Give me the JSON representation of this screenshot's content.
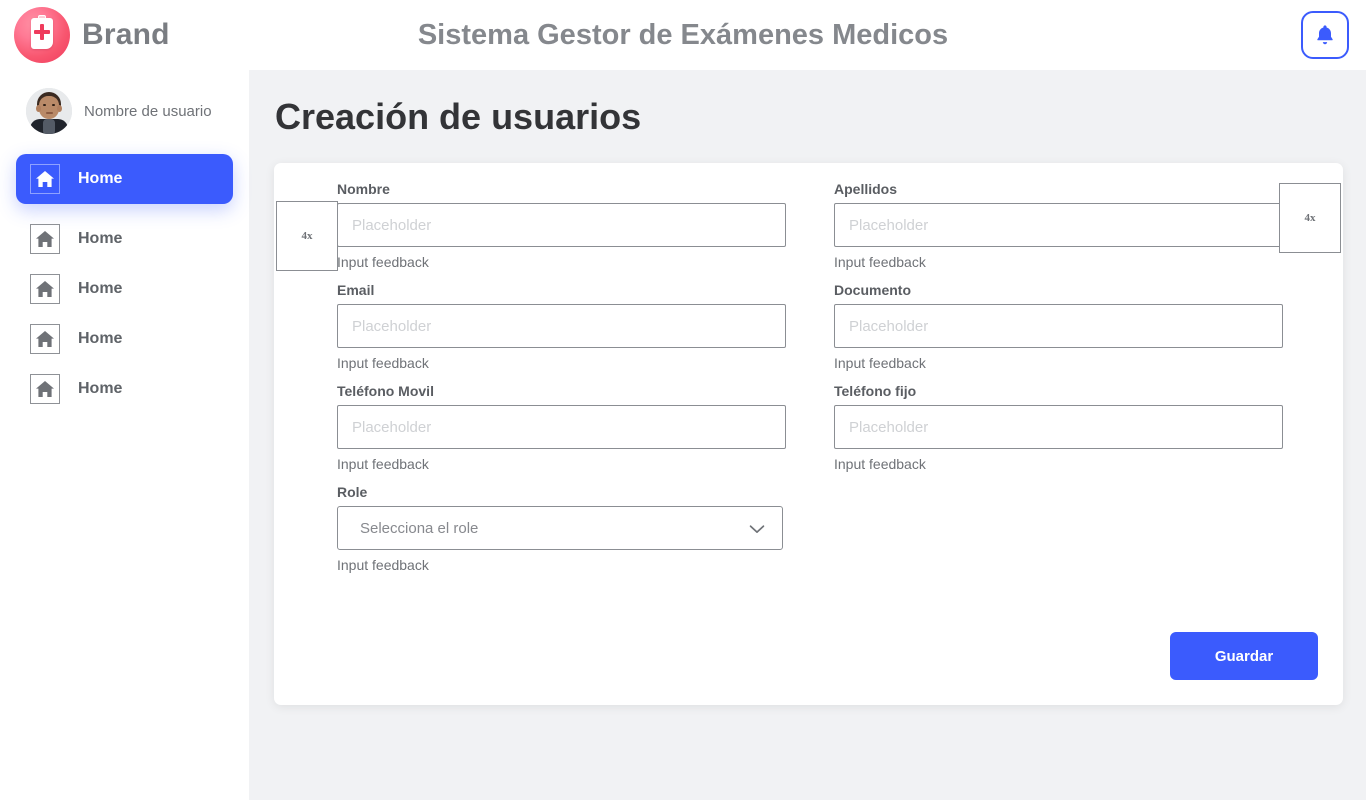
{
  "header": {
    "brand_label": "Brand",
    "app_title": "Sistema Gestor de Exámenes Medicos",
    "notification_icon": "bell-icon",
    "logo_icon": "medical-clipboard-logo"
  },
  "sidebar": {
    "user_name": "Nombre de usuario",
    "avatar_icon": "user-avatar-photo",
    "items": [
      {
        "label": "Home",
        "icon": "home-icon",
        "active": true
      },
      {
        "label": "Home",
        "icon": "home-icon",
        "active": false
      },
      {
        "label": "Home",
        "icon": "home-icon",
        "active": false
      },
      {
        "label": "Home",
        "icon": "home-icon",
        "active": false
      },
      {
        "label": "Home",
        "icon": "home-icon",
        "active": false
      }
    ]
  },
  "main": {
    "page_title": "Creación de usuarios",
    "fields": {
      "nombre": {
        "label": "Nombre",
        "value": "",
        "placeholder": "Placeholder",
        "feedback": "Input feedback"
      },
      "apellidos": {
        "label": "Apellidos",
        "value": "",
        "placeholder": "Placeholder",
        "feedback": "Input feedback"
      },
      "email": {
        "label": "Email",
        "value": "",
        "placeholder": "Placeholder",
        "feedback": "Input feedback"
      },
      "documento": {
        "label": "Documento",
        "value": "",
        "placeholder": "Placeholder",
        "feedback": "Input feedback"
      },
      "telefono_movil": {
        "label": "Teléfono Movil",
        "value": "",
        "placeholder": "Placeholder",
        "feedback": "Input feedback"
      },
      "telefono_fijo": {
        "label": "Teléfono fijo",
        "value": "",
        "placeholder": "Placeholder",
        "feedback": "Input feedback"
      },
      "role": {
        "label": "Role",
        "selected": "Selecciona el role",
        "feedback": "Input feedback",
        "chevron_icon": "chevron-down-icon"
      }
    },
    "save_label": "Guardar"
  },
  "annotations": {
    "left_box_label": "4x",
    "right_box_label": "4x"
  },
  "colors": {
    "accent_blue": "#3b5bfd",
    "page_bg": "#f1f2f4",
    "card_bg": "#ffffff",
    "label_gray": "#5a5d62",
    "placeholder_gray": "#cfd1d4",
    "brand_pink": "#ef3b5c"
  }
}
